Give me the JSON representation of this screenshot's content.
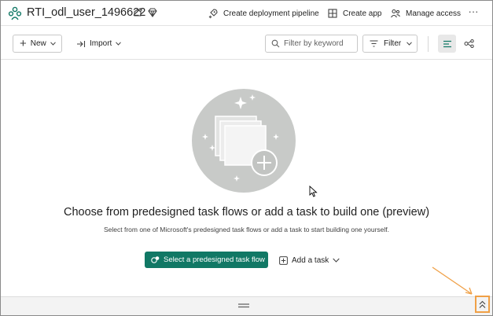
{
  "header": {
    "workspace_title": "RTI_odl_user_1496622",
    "actions": {
      "create_pipeline": "Create deployment pipeline",
      "create_app": "Create app",
      "manage_access": "Manage access"
    },
    "more_label": "···"
  },
  "toolbar": {
    "new_label": "New",
    "import_label": "Import",
    "search_placeholder": "Filter by keyword",
    "filter_label": "Filter"
  },
  "empty_state": {
    "title": "Choose from predesigned task flows or add a task to build one (preview)",
    "subtitle": "Select from one of Microsoft's predesigned task flows or add a task to start building one yourself.",
    "primary_button": "Select a predesigned task flow",
    "secondary_button": "Add a task"
  },
  "icons": {
    "workspace": "workspace-people-icon",
    "sensitivity": "sensitivity-label-icon",
    "premium": "diamond-icon",
    "pipeline": "rocket-icon",
    "app": "app-grid-icon",
    "access": "people-icon",
    "search": "search-icon",
    "filter": "filter-icon",
    "list_view": "list-view-icon",
    "lineage_view": "lineage-icon",
    "expand": "double-chevron-up-icon"
  },
  "colors": {
    "primary": "#117865",
    "workspace_icon": "#117865",
    "highlight": "#f0a046",
    "illustration_bg": "#c8cac8"
  }
}
